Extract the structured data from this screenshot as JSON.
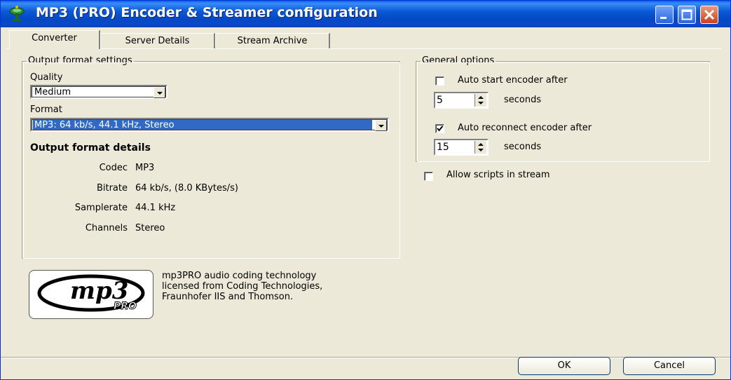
{
  "window": {
    "title": "MP3 (PRO) Encoder & Streamer configuration",
    "icons": {
      "app": "satellite-dish-icon",
      "minimize": "minimize-icon",
      "maximize": "maximize-icon",
      "close": "close-icon"
    }
  },
  "tabs": [
    {
      "label": "Converter",
      "active": true
    },
    {
      "label": "Server Details",
      "active": false
    },
    {
      "label": "Stream Archive",
      "active": false
    }
  ],
  "output_format": {
    "group_title": "Output format settings",
    "quality_label": "Quality",
    "quality_value": "Medium",
    "format_label": "Format",
    "format_value": "MP3: 64 kb/s, 44.1 kHz, Stereo",
    "details_title": "Output format details",
    "details": [
      {
        "label": "Codec",
        "value": "MP3"
      },
      {
        "label": "Bitrate",
        "value": "64 kb/s, (8.0 KBytes/s)"
      },
      {
        "label": "Samplerate",
        "value": "44.1 kHz"
      },
      {
        "label": "Channels",
        "value": "Stereo"
      }
    ]
  },
  "general_options": {
    "group_title": "General options",
    "auto_start": {
      "label": "Auto start encoder after",
      "checked": false,
      "value": "5",
      "unit": "seconds"
    },
    "auto_reconnect": {
      "label": "Auto reconnect encoder after",
      "checked": true,
      "value": "15",
      "unit": "seconds"
    }
  },
  "allow_scripts": {
    "label": "Allow scripts in stream",
    "checked": false
  },
  "logo": {
    "text": "mp3",
    "subtext": "PRO"
  },
  "credit_lines": [
    "mp3PRO audio coding technology",
    "licensed from Coding Technologies,",
    "Fraunhofer IIS and Thomson."
  ],
  "buttons": {
    "ok": "OK",
    "cancel": "Cancel"
  },
  "colors": {
    "titlebar": "#0548c4",
    "selection": "#316ac5",
    "face": "#ece9d8"
  }
}
